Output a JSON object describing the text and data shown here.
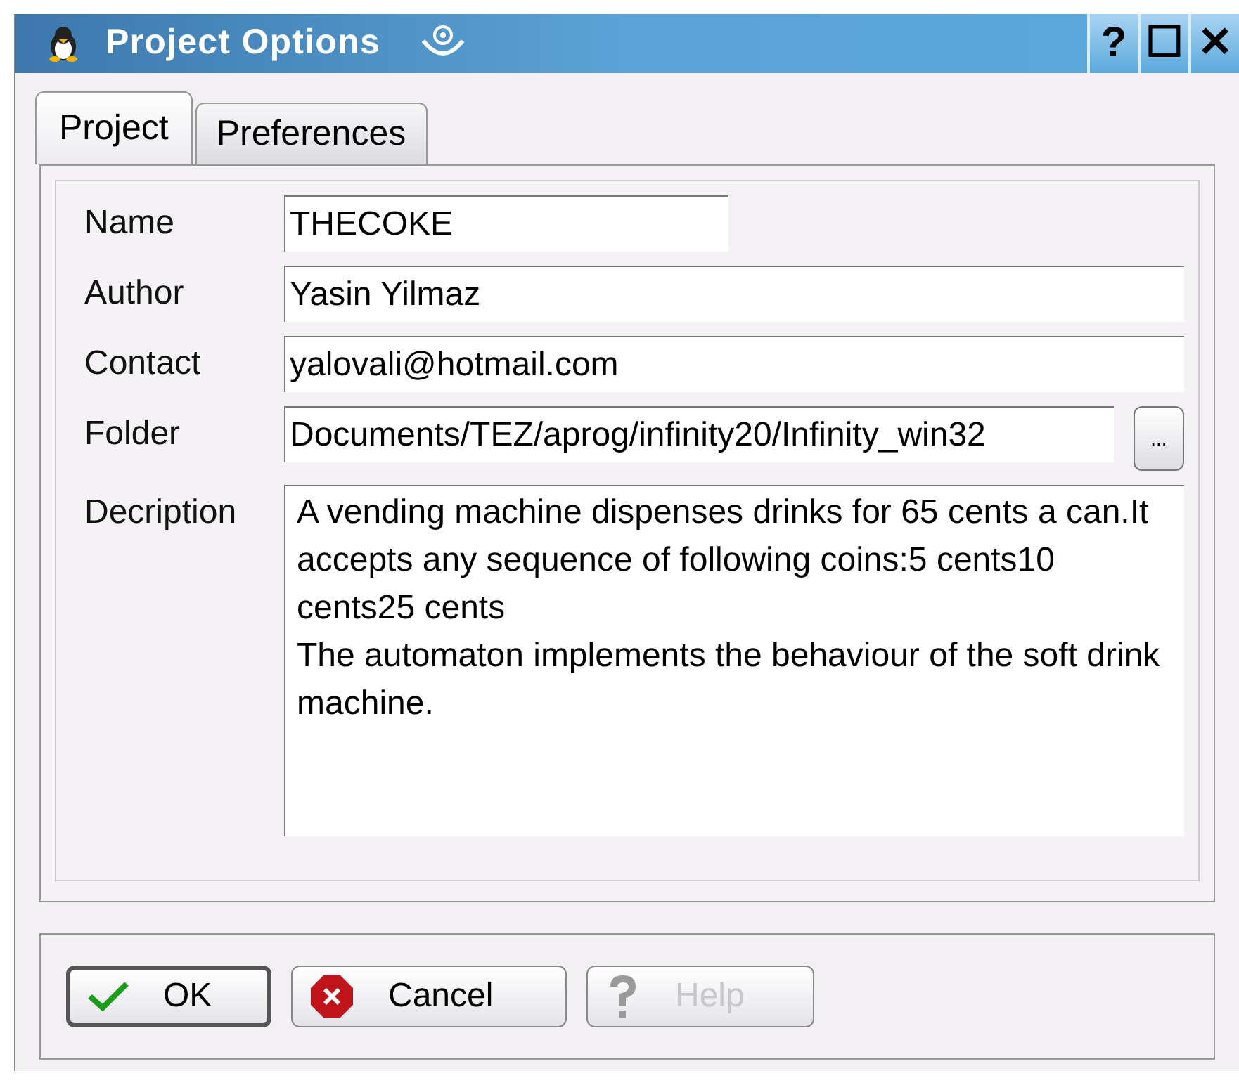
{
  "window": {
    "title": "Project Options",
    "buttons": [
      "?",
      "☐",
      "✕"
    ]
  },
  "tabs": [
    {
      "label": "Project",
      "selected": true
    },
    {
      "label": "Preferences",
      "selected": false
    }
  ],
  "fields": [
    {
      "kind": "line",
      "label": "Name",
      "value": "THECOKE",
      "short": true
    },
    {
      "kind": "line",
      "label": "Author",
      "value": "Yasin Yilmaz",
      "short": false
    },
    {
      "kind": "line",
      "label": "Contact",
      "value": "yalovali@hotmail.com",
      "short": false
    },
    {
      "kind": "browse",
      "label": "Folder",
      "value": "Documents/TEZ/aprog/infinity20/Infinity_win32",
      "button": "...",
      "short": false
    },
    {
      "kind": "multi",
      "label": "Decription",
      "value": "A vending machine dispenses drinks for 65 cents a can.It accepts any sequence of following coins:5 cents10 cents25 cents\nThe automaton implements the behaviour of the soft drink machine.",
      "short": false
    }
  ],
  "buttons": [
    {
      "kind": "ok",
      "label": "OK",
      "default": true,
      "disabled": false
    },
    {
      "kind": "cancel",
      "label": "Cancel",
      "default": false,
      "disabled": false
    },
    {
      "kind": "help",
      "label": "Help",
      "default": false,
      "disabled": true
    }
  ]
}
